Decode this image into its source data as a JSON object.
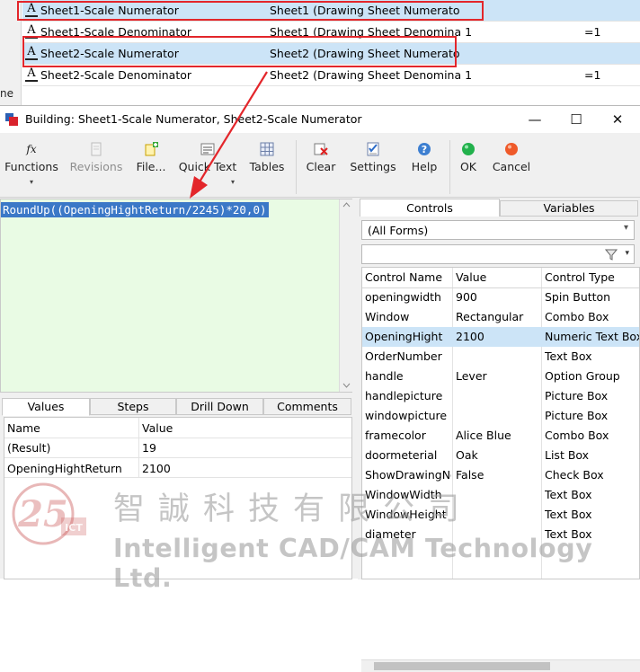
{
  "background": {
    "left_fragment": "ne",
    "rows": [
      {
        "name": "Sheet1-Scale Numerator",
        "formula": "Sheet1 (Drawing Sheet Numerato",
        "value": "",
        "selected": true
      },
      {
        "name": "Sheet1-Scale Denominator",
        "formula": "Sheet1 (Drawing Sheet Denomina 1",
        "value": "=1",
        "selected": false
      },
      {
        "name": "Sheet2-Scale Numerator",
        "formula": "Sheet2 (Drawing Sheet Numerato",
        "value": "",
        "selected": true
      },
      {
        "name": "Sheet2-Scale Denominator",
        "formula": "Sheet2 (Drawing Sheet Denomina 1",
        "value": "=1",
        "selected": false
      }
    ],
    "row_icon": "A"
  },
  "dialog": {
    "title": "Building: Sheet1-Scale Numerator, Sheet2-Scale Numerator",
    "window_buttons": {
      "minimize": "—",
      "maximize": "☐",
      "close": "✕"
    }
  },
  "ribbon": {
    "functions": "Functions",
    "revisions": "Revisions",
    "file": "File...",
    "quicktext": "Quick Text",
    "tables": "Tables",
    "clear": "Clear",
    "settings": "Settings",
    "help": "Help",
    "ok": "OK",
    "cancel": "Cancel",
    "fx_glyph": "fx",
    "dropdown_glyph": "▾"
  },
  "editor": {
    "formula": "RoundUp((OpeningHightReturn/2245)*20,0)"
  },
  "lower_tabs": [
    "Values",
    "Steps",
    "Drill Down",
    "Comments"
  ],
  "values_grid": {
    "headers": [
      "Name",
      "Value"
    ],
    "rows": [
      {
        "name": "(Result)",
        "value": "19"
      },
      {
        "name": "OpeningHightReturn",
        "value": "2100"
      }
    ]
  },
  "right_panel": {
    "tabs": [
      "Controls",
      "Variables"
    ],
    "forms_combo": "(All Forms)",
    "filter_placeholder": "",
    "headers": [
      "Control Name",
      "Value",
      "Control Type"
    ],
    "rows": [
      {
        "name": "openingwidth",
        "value": "900",
        "type": "Spin Button",
        "selected": false
      },
      {
        "name": "Window",
        "value": "Rectangular",
        "type": "Combo Box",
        "selected": false
      },
      {
        "name": "OpeningHight",
        "value": "2100",
        "type": "Numeric Text Box",
        "selected": true
      },
      {
        "name": "OrderNumber",
        "value": "",
        "type": "Text Box",
        "selected": false
      },
      {
        "name": "handle",
        "value": "Lever",
        "type": "Option Group",
        "selected": false
      },
      {
        "name": "handlepicture",
        "value": "",
        "type": "Picture Box",
        "selected": false
      },
      {
        "name": "windowpicture",
        "value": "",
        "type": "Picture Box",
        "selected": false
      },
      {
        "name": "framecolor",
        "value": "Alice Blue",
        "type": "Combo Box",
        "selected": false
      },
      {
        "name": "doormeterial",
        "value": "Oak",
        "type": "List Box",
        "selected": false
      },
      {
        "name": "ShowDrawingNo",
        "value": "False",
        "type": "Check Box",
        "selected": false
      },
      {
        "name": "WindowWidth",
        "value": "",
        "type": "Text Box",
        "selected": false
      },
      {
        "name": "WindowHeight",
        "value": "",
        "type": "Text Box",
        "selected": false
      },
      {
        "name": "diameter",
        "value": "",
        "type": "Text Box",
        "selected": false
      }
    ]
  },
  "watermark": {
    "chinese": "智誠科技有限公司",
    "english": "Intelligent CAD/CAM Technology Ltd.",
    "logo_number": "25",
    "logo_caption": "ICT"
  },
  "colors": {
    "highlight_box": "#e3262b",
    "selection": "#cce4f7",
    "editor_bg": "#e9fbe4",
    "formula_highlight": "#3b78c7"
  }
}
